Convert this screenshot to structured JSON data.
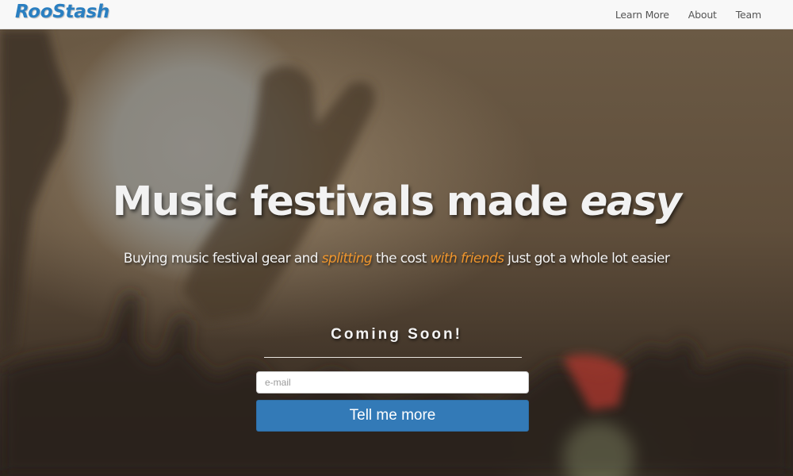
{
  "nav": {
    "brand": "RooStash",
    "links": [
      {
        "label": "Learn More"
      },
      {
        "label": "About"
      },
      {
        "label": "Team"
      }
    ]
  },
  "hero": {
    "headline_main": "Music festivals made ",
    "headline_emphasis": "easy",
    "subhead_parts": {
      "p1": "Buying music festival gear and ",
      "accent1": "splitting",
      "p2": " the cost ",
      "accent2": "with friends",
      "p3": " just got a whole lot easier"
    },
    "coming_soon": "Coming Soon!",
    "email_placeholder": "e-mail",
    "email_value": "",
    "submit_label": "Tell me more"
  },
  "colors": {
    "brand": "#2a7fc1",
    "accent": "#f0962d",
    "button": "#337ab7",
    "navbar_bg": "#f8f8f8"
  },
  "icons": []
}
